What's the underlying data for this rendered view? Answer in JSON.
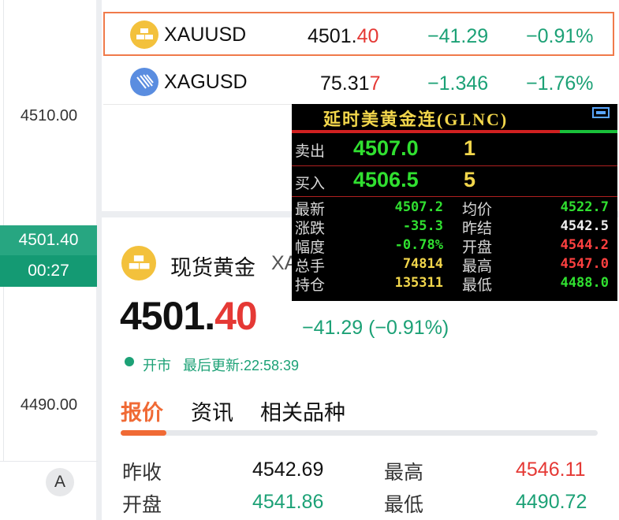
{
  "chart_axis": {
    "labels": [
      "4510.00",
      "4490.00"
    ],
    "current_price": "4501.40",
    "countdown": "00:27",
    "avatar_letter": "A"
  },
  "watchlist": [
    {
      "symbol": "XAUUSD",
      "price_main": "4501.",
      "price_tail": "40",
      "change": "−41.29",
      "change_pct": "−0.91%",
      "icon": "gold-bars-icon",
      "selected": true
    },
    {
      "symbol": "XAGUSD",
      "price_main": "75.31",
      "price_tail": "7",
      "change": "−1.346",
      "change_pct": "−1.76%",
      "icon": "silver-bars-icon",
      "selected": false
    }
  ],
  "detail": {
    "name": "现货黄金",
    "symbol_partial": "XA",
    "price_main": "4501.",
    "price_tail": "40",
    "change_line": "−41.29 (−0.91%)",
    "status": "开市",
    "last_update": "最后更新:22:58:39",
    "tabs": [
      "报价",
      "资讯",
      "相关品种"
    ],
    "quotes": [
      {
        "label": "昨收",
        "value": "4542.69",
        "label2": "最高",
        "value2": "4546.11"
      },
      {
        "label": "开盘",
        "value": "4541.86",
        "label2": "最低",
        "value2": "4490.72"
      }
    ]
  },
  "overlay": {
    "title": "延时美黄金连(GLNC)",
    "sell_label": "卖出",
    "sell_price": "4507.0",
    "sell_qty": "1",
    "buy_label": "买入",
    "buy_price": "4506.5",
    "buy_qty": "5",
    "rows": [
      {
        "l1": "最新",
        "v1": "4507.2",
        "l2": "均价",
        "v2": "4522.7"
      },
      {
        "l1": "涨跌",
        "v1": "-35.3",
        "l2": "昨结",
        "v2": "4542.5"
      },
      {
        "l1": "幅度",
        "v1": "-0.78%",
        "l2": "开盘",
        "v2": "4544.2"
      },
      {
        "l1": "总手",
        "v1": "74814",
        "l2": "最高",
        "v2": "4547.0"
      },
      {
        "l1": "持仓",
        "v1": "135311",
        "l2": "最低",
        "v2": "4488.0"
      }
    ]
  },
  "colors": {
    "up": "#1ca176",
    "down": "#e53935",
    "accent": "#f06a35"
  }
}
